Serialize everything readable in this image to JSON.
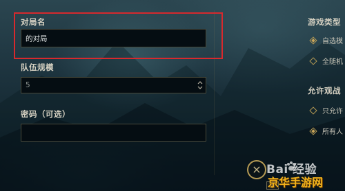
{
  "form": {
    "lobby_name": {
      "label": "对局名",
      "value": "的对局"
    },
    "team_size": {
      "label": "队伍规模",
      "value": "5"
    },
    "password": {
      "label": "密码（可选）",
      "value": ""
    }
  },
  "right_panel": {
    "game_type": {
      "label": "游戏类型",
      "options": [
        {
          "label": "自选模",
          "selected": true
        },
        {
          "label": "全随机",
          "selected": false
        }
      ]
    },
    "spectate": {
      "label": "允许观战",
      "options": [
        {
          "label": "只允许",
          "selected": false
        },
        {
          "label": "所有人",
          "selected": true
        }
      ]
    }
  },
  "bottom": {
    "close_symbol": "×",
    "partial_button_text": "而"
  },
  "watermarks": {
    "baidu": "Bai  经验",
    "site": "京华手游网"
  },
  "colors": {
    "highlight_border": "#d8292d",
    "gold_accent": "#b59a54",
    "field_bg": "#050d12",
    "site_watermark": "#f0b21c"
  }
}
